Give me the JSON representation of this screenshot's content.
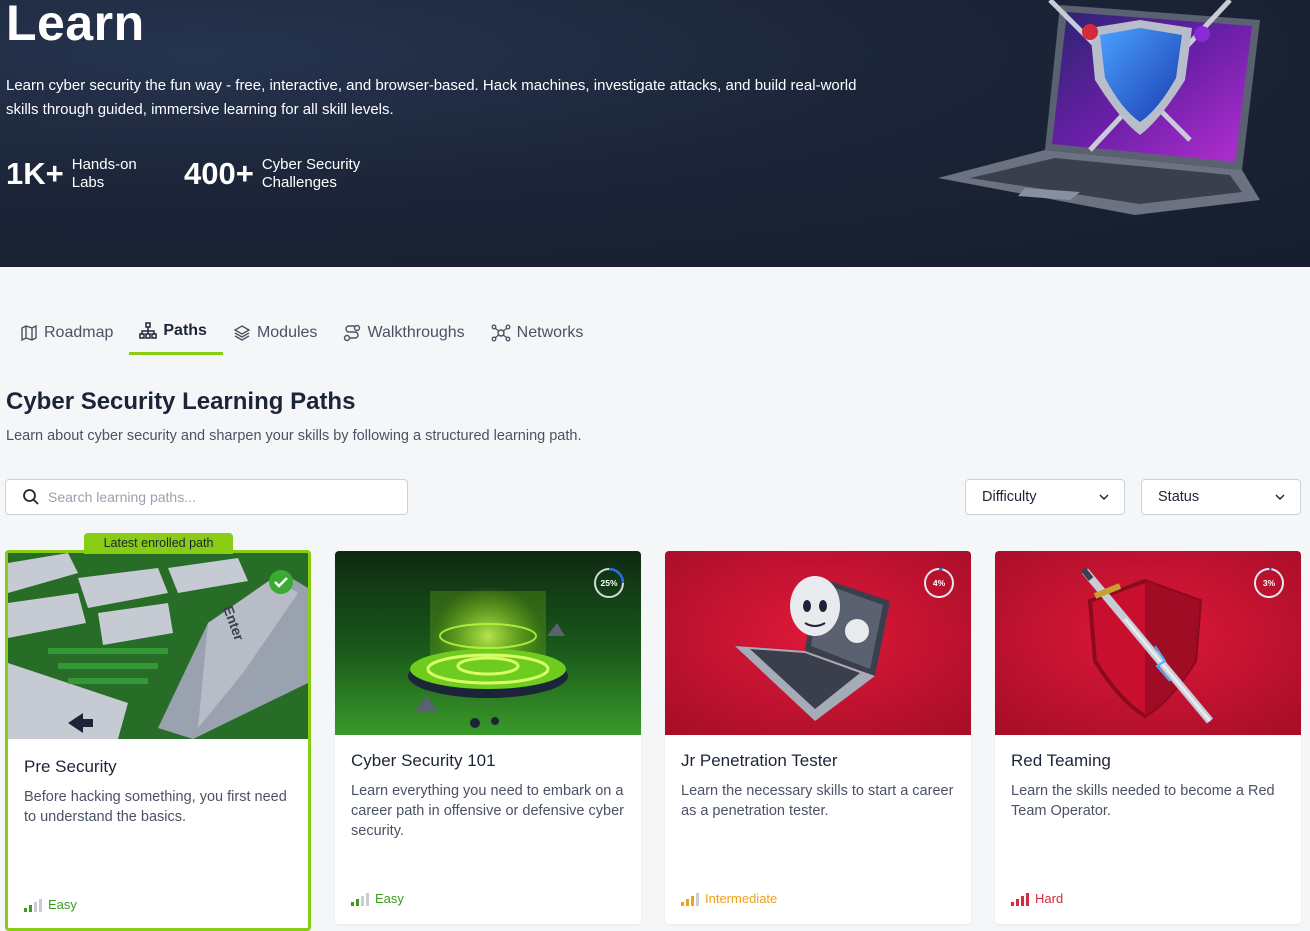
{
  "hero": {
    "title": "Learn",
    "description": "Learn cyber security the fun way - free, interactive, and browser-based. Hack machines, investigate attacks, and build real-world skills through guided, immersive learning for all skill levels.",
    "stats": [
      {
        "value": "1K+",
        "label": "Hands-on Labs"
      },
      {
        "value": "400+",
        "label": "Cyber Security Challenges"
      }
    ]
  },
  "tabs": [
    {
      "label": "Roadmap",
      "icon": "map-icon"
    },
    {
      "label": "Paths",
      "icon": "hierarchy-icon",
      "active": true
    },
    {
      "label": "Modules",
      "icon": "layers-icon"
    },
    {
      "label": "Walkthroughs",
      "icon": "route-icon"
    },
    {
      "label": "Networks",
      "icon": "network-icon"
    }
  ],
  "section": {
    "title": "Cyber Security Learning Paths",
    "subtitle": "Learn about cyber security and sharpen your skills by following a structured learning path."
  },
  "filters": {
    "search_placeholder": "Search learning paths...",
    "difficulty_label": "Difficulty",
    "status_label": "Status"
  },
  "badge": "Latest enrolled path",
  "cards": [
    {
      "title": "Pre Security",
      "description": "Before hacking something, you first need to understand the basics.",
      "difficulty": "Easy",
      "completed": true
    },
    {
      "title": "Cyber Security 101",
      "description": "Learn everything you need to embark on a career path in offensive or defensive cyber security.",
      "difficulty": "Easy",
      "progress": "25%"
    },
    {
      "title": "Jr Penetration Tester",
      "description": "Learn the necessary skills to start a career as a penetration tester.",
      "difficulty": "Intermediate",
      "progress": "4%"
    },
    {
      "title": "Red Teaming",
      "description": "Learn the skills needed to become a Red Team Operator.",
      "difficulty": "Hard",
      "progress": "3%"
    }
  ],
  "colors": {
    "hero_bg": "#1c2538",
    "accent_green": "#88cc14",
    "easy": "#3d9b1f",
    "intermediate": "#f0a020",
    "hard": "#d42a3c",
    "card_green_bg": "#2a8a2a",
    "card_red_bg": "#c8102e"
  }
}
